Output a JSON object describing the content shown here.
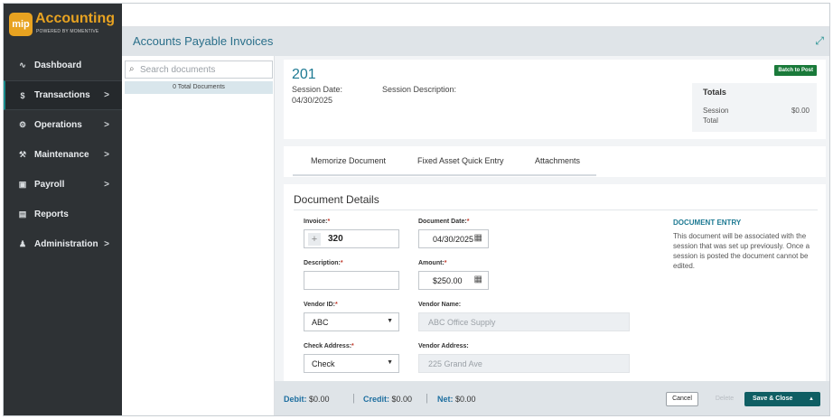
{
  "app": {
    "logo_badge": "mip",
    "logo_title": "Accounting",
    "logo_sub": "POWERED BY MOMENTIVE"
  },
  "nav": {
    "items": [
      {
        "label": "Dashboard",
        "icon": "chart-line-icon",
        "glyph": "∿",
        "chevron": ""
      },
      {
        "label": "Transactions",
        "icon": "dollar-icon",
        "glyph": "$",
        "chevron": ">"
      },
      {
        "label": "Operations",
        "icon": "gears-icon",
        "glyph": "⚙",
        "chevron": ">"
      },
      {
        "label": "Maintenance",
        "icon": "wrench-icon",
        "glyph": "⚒",
        "chevron": ">"
      },
      {
        "label": "Payroll",
        "icon": "money-icon",
        "glyph": "▣",
        "chevron": ">"
      },
      {
        "label": "Reports",
        "icon": "document-icon",
        "glyph": "▤",
        "chevron": ""
      },
      {
        "label": "Administration",
        "icon": "users-icon",
        "glyph": "♟",
        "chevron": ">"
      }
    ]
  },
  "header": {
    "title": "Accounts Payable Invoices",
    "expand_glyph": "⤢"
  },
  "doclist": {
    "search_placeholder": "Search documents",
    "search_glyph": "⌕",
    "count_text": "0 Total Documents"
  },
  "session": {
    "number": "201",
    "date_label": "Session Date:",
    "date_value": "04/30/2025",
    "desc_label": "Session Description:",
    "batch_button": "Batch to Post",
    "totals_title": "Totals",
    "totals_label_1": "Session",
    "totals_label_2": "Total",
    "totals_value": "$0.00"
  },
  "tabs": [
    "Memorize Document",
    "Fixed Asset Quick Entry",
    "Attachments"
  ],
  "details": {
    "title": "Document Details",
    "invoice_label": "Invoice:",
    "invoice_value": "320",
    "doc_date_label": "Document Date:",
    "doc_date_value": "04/30/2025",
    "description_label": "Description:",
    "description_value": "",
    "amount_label": "Amount:",
    "amount_value": "$250.00",
    "vendor_id_label": "Vendor ID:",
    "vendor_id_value": "ABC",
    "vendor_name_label": "Vendor Name:",
    "vendor_name_value": "ABC Office Supply",
    "check_address_label": "Check Address:",
    "check_address_value": "Check",
    "vendor_address_label": "Vendor Address:",
    "vendor_address_value": "225 Grand Ave",
    "required_mark": "*",
    "entry_title": "DOCUMENT ENTRY",
    "entry_text": "This document will be associated with the session that was set up previously. Once a session is posted the document cannot be edited."
  },
  "footer": {
    "debit_label": "Debit:",
    "debit_value": "$0.00",
    "credit_label": "Credit:",
    "credit_value": "$0.00",
    "net_label": "Net:",
    "net_value": "$0.00",
    "cancel_label": "Cancel",
    "delete_label": "Delete",
    "save_label": "Save & Close",
    "save_caret": "▲"
  },
  "colors": {
    "sidebar": "#2e3235",
    "brand": "#e8a321",
    "accent": "#1e7a93",
    "save_button": "#0f5e63",
    "batch_button": "#1a7a3a"
  }
}
